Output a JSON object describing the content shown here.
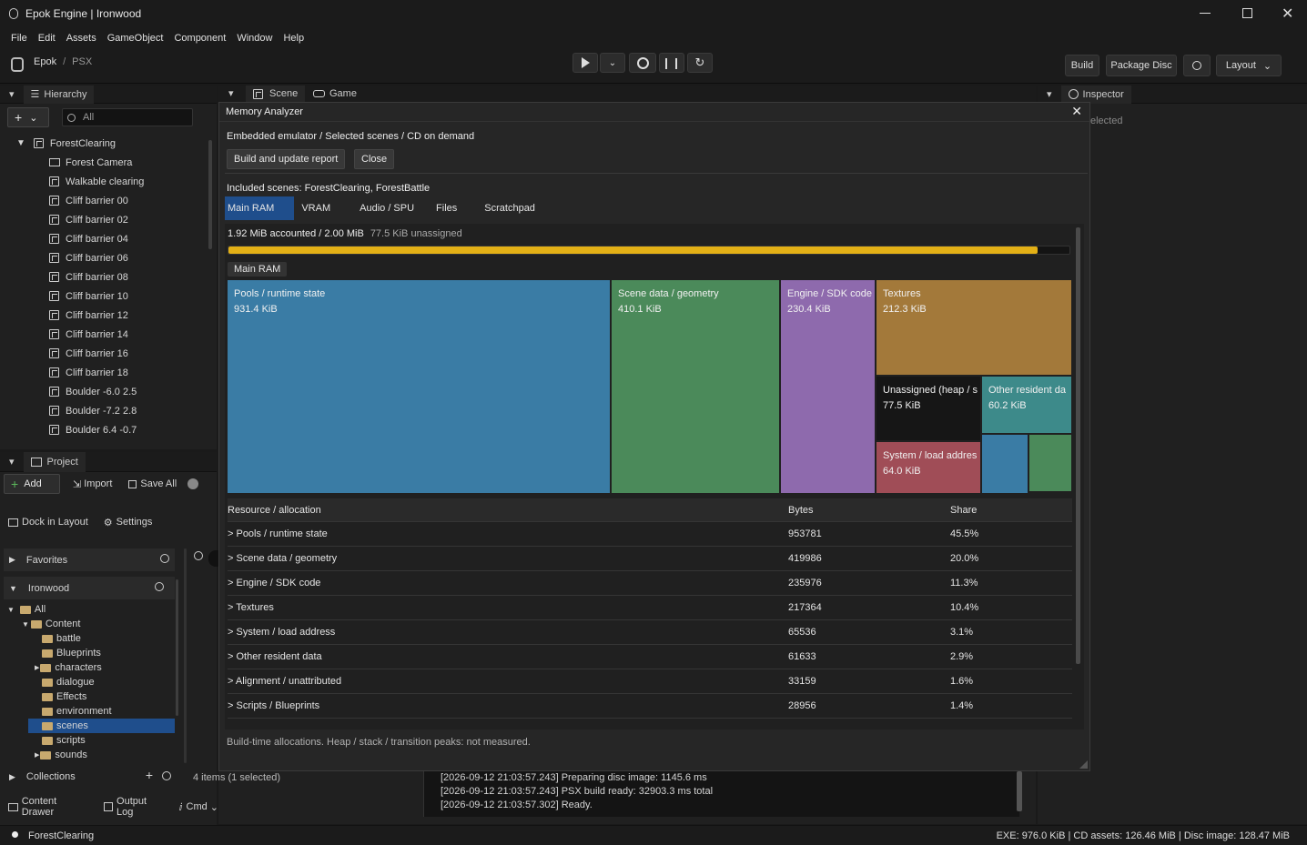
{
  "window": {
    "title": "Epok Engine | Ironwood"
  },
  "menu": [
    "File",
    "Edit",
    "Assets",
    "GameObject",
    "Component",
    "Window",
    "Help"
  ],
  "breadcrumb": {
    "root": "Epok",
    "sep": "/",
    "leaf": "PSX"
  },
  "toolbar": {
    "build": "Build",
    "package": "Package Disc",
    "layout": "Layout"
  },
  "hierarchy": {
    "tab": "Hierarchy",
    "search_placeholder": "All",
    "root": "ForestClearing",
    "items": [
      "Forest Camera",
      "Walkable clearing",
      "Cliff barrier 00",
      "Cliff barrier 02",
      "Cliff barrier 04",
      "Cliff barrier 06",
      "Cliff barrier 08",
      "Cliff barrier 10",
      "Cliff barrier 12",
      "Cliff barrier 14",
      "Cliff barrier 16",
      "Cliff barrier 18",
      "Boulder -6.0 2.5",
      "Boulder -7.2 2.8",
      "Boulder 6.4 -0.7"
    ]
  },
  "center_tabs": {
    "scene": "Scene",
    "game": "Game"
  },
  "inspector": {
    "tab": "Inspector",
    "text": "elected"
  },
  "project": {
    "tab": "Project",
    "add": "Add",
    "import": "Import",
    "save_all": "Save All",
    "dock": "Dock in Layout",
    "settings": "Settings",
    "favorites": "Favorites",
    "ironwood": "Ironwood",
    "tree": {
      "all": "All",
      "content": "Content",
      "folders": [
        "battle",
        "Blueprints",
        "characters",
        "dialogue",
        "Effects",
        "environment",
        "scenes",
        "scripts",
        "sounds"
      ]
    },
    "collections": "Collections",
    "items_count": "4 items (1 selected)"
  },
  "bottom_tabs": {
    "drawer": "Content Drawer",
    "log": "Output Log",
    "cmd": "Cmd"
  },
  "log_lines": [
    "[2026-09-12 21:03:57.243] Preparing disc image: 1145.6 ms",
    "[2026-09-12 21:03:57.243] PSX build ready: 32903.3 ms total",
    "[2026-09-12 21:03:57.302] Ready."
  ],
  "modal": {
    "title": "Memory Analyzer",
    "context": "Embedded emulator / Selected scenes / CD on demand",
    "build_btn": "Build and update report",
    "close_btn": "Close",
    "included": "Included scenes: ForestClearing, ForestBattle",
    "tabs": [
      "Main RAM",
      "VRAM",
      "Audio / SPU",
      "Files",
      "Scratchpad"
    ],
    "accounted": "1.92 MiB accounted / 2.00 MiB",
    "unassigned": "77.5 KiB unassigned",
    "usage_fraction": 0.962,
    "section_label": "Main RAM",
    "treemap": [
      {
        "name": "Pools / runtime state",
        "size": "931.4 KiB",
        "color": "#3a7ca5"
      },
      {
        "name": "Scene data / geometry",
        "size": "410.1 KiB",
        "color": "#4b8a5a"
      },
      {
        "name": "Engine / SDK code",
        "size": "230.4 KiB",
        "color": "#8e6aad"
      },
      {
        "name": "Textures",
        "size": "212.3 KiB",
        "color": "#a3793a"
      },
      {
        "name": "Unassigned (heap / s",
        "size": "77.5 KiB",
        "color": "#161616"
      },
      {
        "name": "Other resident da",
        "size": "60.2 KiB",
        "color": "#3d8a8a"
      },
      {
        "name": "System / load addres",
        "size": "64.0 KiB",
        "color": "#a04d57"
      }
    ],
    "table": {
      "headers": [
        "Resource / allocation",
        "Bytes",
        "Share"
      ],
      "rows": [
        [
          "> Pools / runtime state",
          "953781",
          "45.5%"
        ],
        [
          "> Scene data / geometry",
          "419986",
          "20.0%"
        ],
        [
          "> Engine / SDK code",
          "235976",
          "11.3%"
        ],
        [
          "> Textures",
          "217364",
          "10.4%"
        ],
        [
          "> System / load address",
          "65536",
          "3.1%"
        ],
        [
          "> Other resident data",
          "61633",
          "2.9%"
        ],
        [
          "> Alignment / unattributed",
          "33159",
          "1.6%"
        ],
        [
          "> Scripts / Blueprints",
          "28956",
          "1.4%"
        ]
      ]
    },
    "footer": "Build-time allocations. Heap / stack / transition peaks: not measured."
  },
  "status": {
    "scene": "ForestClearing",
    "right": "EXE: 976.0 KiB | CD assets: 126.46 MiB | Disc image: 128.47 MiB"
  }
}
